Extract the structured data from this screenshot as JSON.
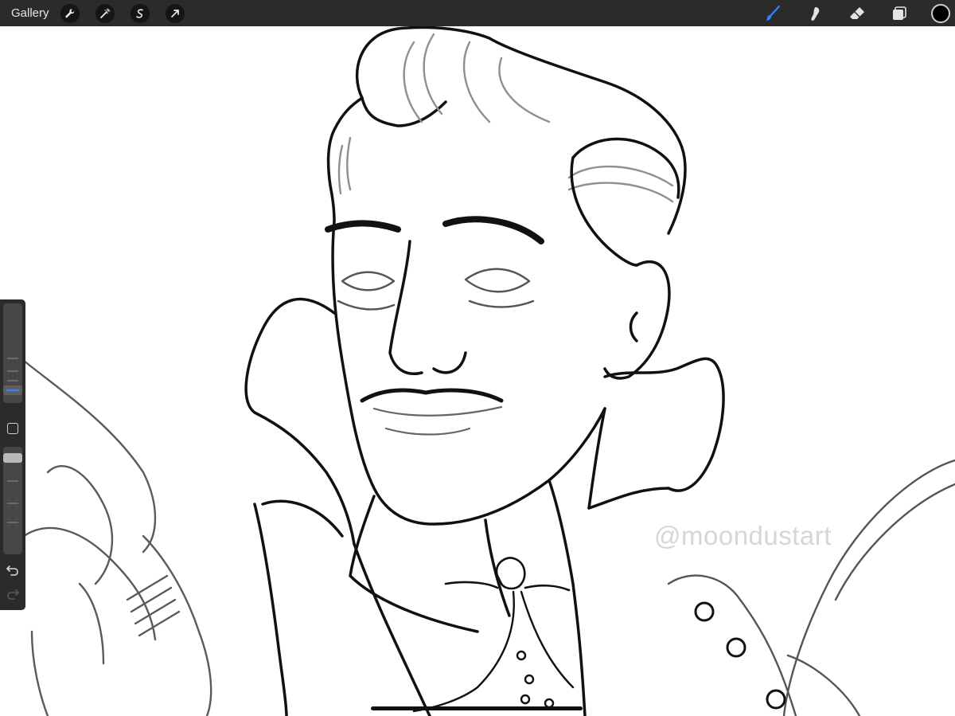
{
  "topbar": {
    "gallery_label": "Gallery",
    "left_tools": [
      "wrench-icon",
      "magic-wand-icon",
      "selection-icon",
      "transform-arrow-icon"
    ],
    "right_tools": [
      "brush-icon",
      "smudge-icon",
      "eraser-icon",
      "layers-icon"
    ],
    "current_color": "#000000",
    "active_tool_color": "#2d86ff"
  },
  "canvas": {
    "watermark": "@moondustart"
  },
  "sidebar": {
    "controls": [
      "brush-size-slider",
      "modify-button",
      "opacity-slider",
      "undo-icon",
      "redo-icon"
    ]
  }
}
